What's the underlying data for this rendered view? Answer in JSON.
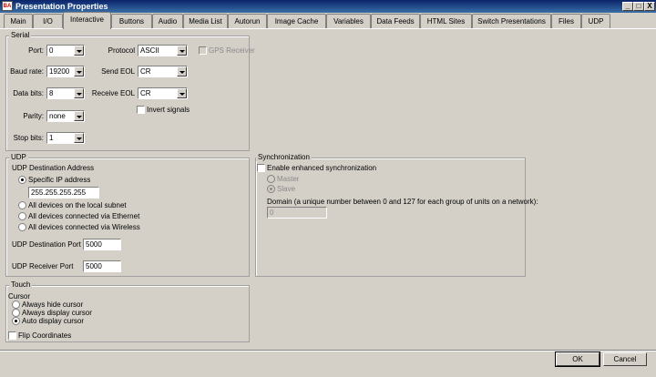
{
  "window": {
    "app_icon": "BA",
    "title": "Presentation Properties",
    "minimize": "_",
    "maximize": "□",
    "close": "X"
  },
  "tabs": [
    {
      "label": "Main"
    },
    {
      "label": "I/O"
    },
    {
      "label": "Interactive",
      "active": true
    },
    {
      "label": "Buttons"
    },
    {
      "label": "Audio"
    },
    {
      "label": "Media List"
    },
    {
      "label": "Autorun"
    },
    {
      "label": "Image Cache"
    },
    {
      "label": "Variables"
    },
    {
      "label": "Data Feeds"
    },
    {
      "label": "HTML Sites"
    },
    {
      "label": "Switch Presentations"
    },
    {
      "label": "Files"
    },
    {
      "label": "UDP"
    }
  ],
  "serial": {
    "title": "Serial",
    "port_label": "Port:",
    "port_value": "0",
    "protocol_label": "Protocol",
    "protocol_value": "ASCII",
    "gps_receiver_label": "GPS Receiver",
    "baud_label": "Baud rate:",
    "baud_value": "19200",
    "send_eol_label": "Send EOL",
    "send_eol_value": "CR",
    "data_bits_label": "Data bits:",
    "data_bits_value": "8",
    "receive_eol_label": "Receive EOL",
    "receive_eol_value": "CR",
    "invert_signals_label": "Invert signals",
    "parity_label": "Parity:",
    "parity_value": "none",
    "stop_bits_label": "Stop bits:",
    "stop_bits_value": "1"
  },
  "udp": {
    "title": "UDP",
    "dest_address_label": "UDP Destination Address",
    "specific_ip_label": "Specific IP address",
    "ip_value": "255.255.255.255",
    "local_subnet_label": "All devices on the local subnet",
    "ethernet_label": "All devices connected via Ethernet",
    "wireless_label": "All devices connected via Wireless",
    "dest_port_label": "UDP Destination Port",
    "dest_port_value": "5000",
    "receiver_port_label": "UDP Receiver Port",
    "receiver_port_value": "5000"
  },
  "sync": {
    "title": "Synchronization",
    "enable_label": "Enable enhanced synchronization",
    "master_label": "Master",
    "slave_label": "Slave",
    "domain_label": "Domain (a unique number between 0 and 127 for each group of units on a network):",
    "domain_value": "0"
  },
  "touch": {
    "title": "Touch",
    "cursor_label": "Cursor",
    "always_hide_label": "Always hide cursor",
    "always_display_label": "Always display cursor",
    "auto_display_label": "Auto display cursor",
    "flip_label": "Flip Coordinates"
  },
  "footer": {
    "ok_label": "OK",
    "cancel_label": "Cancel"
  }
}
